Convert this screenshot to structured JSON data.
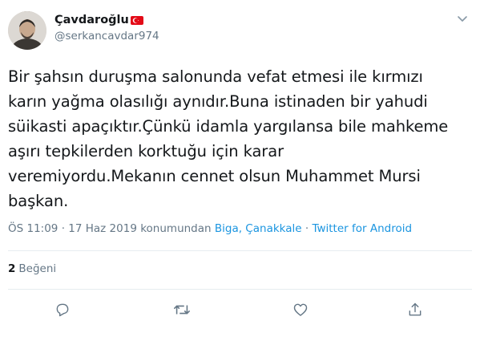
{
  "author": {
    "display_name": "Çavdaroğlu",
    "handle": "@serkancavdar974",
    "avatar_icon": "user-avatar",
    "flag_icon": "turkey-flag-icon"
  },
  "tweet": {
    "text": "Bir şahsın duruşma salonunda vefat etmesi ile kırmızı\nkarın yağma olasılığı aynıdır.Buna istinaden bir yahudi\nsüikasti apaçıktır.Çünkü idamla yargılansa bile mahkeme\naşırı tepkilerden korktuğu için karar\nveremiyordu.Mekanın cennet olsun Muhammet Mursi\nbaşkan."
  },
  "meta": {
    "time": "ÖS 11:09",
    "separator1": " · ",
    "date": "17 Haz 2019",
    "location_prefix": " konumundan ",
    "location": "Biga, Çanakkale",
    "separator2": " · ",
    "source": "Twitter for Android"
  },
  "stats": {
    "likes_count": "2",
    "likes_label": "Beğeni"
  },
  "actions": {
    "reply_icon": "reply-icon",
    "retweet_icon": "retweet-icon",
    "like_icon": "heart-icon",
    "share_icon": "share-icon"
  },
  "colors": {
    "text": "#14171a",
    "secondary": "#657786",
    "link": "#1b95e0",
    "divider": "#e6ecf0",
    "flag": "#e30a17"
  }
}
